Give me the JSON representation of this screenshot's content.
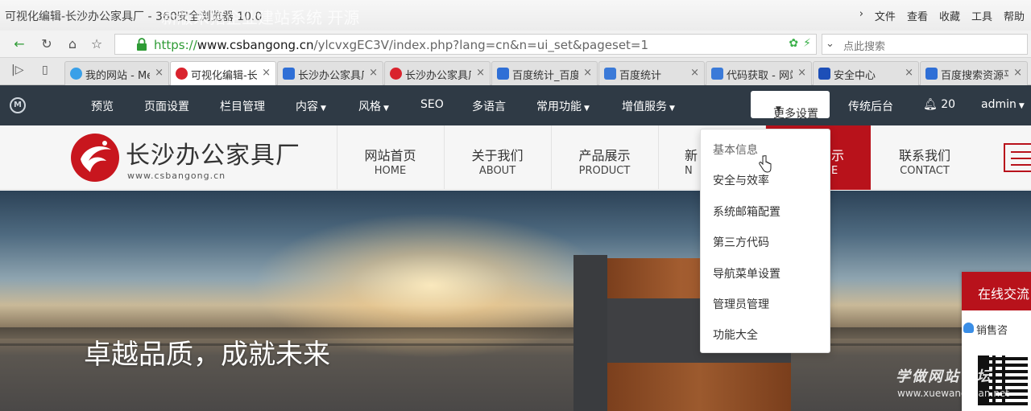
{
  "browser": {
    "window_title": "可视化编辑-长沙办公家具厂 - 360安全浏览器 10.0",
    "title_ghost": "新版米拓企业建站系统 开源",
    "menu": [
      "文件",
      "查看",
      "收藏",
      "工具",
      "帮助"
    ],
    "url_protocol": "https://",
    "url_domain": "www.csbangong.cn",
    "url_path": "/ylcvxgEC3V/index.php?lang=cn&n=ui_set&pageset=1",
    "search_placeholder": "点此搜索",
    "tabs": [
      {
        "label": "我的网站 - Me",
        "favicon_color": "#3aa0e8"
      },
      {
        "label": "可视化编辑-长沙",
        "favicon_color": "#d9232d"
      },
      {
        "label": "长沙办公家具厂",
        "favicon_color": "#2f6fd6"
      },
      {
        "label": "长沙办公家具厂",
        "favicon_color": "#d9232d"
      },
      {
        "label": "百度统计_百度",
        "favicon_color": "#2f6fd6"
      },
      {
        "label": "百度统计",
        "favicon_color": "#3b7ad8"
      },
      {
        "label": "代码获取 - 网站",
        "favicon_color": "#3b7ad8"
      },
      {
        "label": "安全中心",
        "favicon_color": "#1d4fb8"
      },
      {
        "label": "百度搜索资源平",
        "favicon_color": "#2f6fd6"
      }
    ]
  },
  "admin_bar": {
    "items": [
      "预览",
      "页面设置",
      "栏目管理",
      "内容",
      "风格",
      "SEO",
      "多语言",
      "常用功能",
      "增值服务"
    ],
    "more_settings": "更多设置",
    "classic_backend": "传统后台",
    "notification_count": "20",
    "user": "admin"
  },
  "site": {
    "brand_name": "长沙办公家具厂",
    "brand_url": "www.csbangong.cn",
    "nav": [
      {
        "zh": "网站首页",
        "en": "HOME"
      },
      {
        "zh": "关于我们",
        "en": "ABOUT"
      },
      {
        "zh": "产品展示",
        "en": "PRODUCT"
      },
      {
        "zh": "新",
        "en": "N"
      },
      {
        "zh": "示",
        "en": "E"
      },
      {
        "zh": "联系我们",
        "en": "CONTACT"
      }
    ],
    "hero_slogan": "卓越品质，成就未来"
  },
  "dropdown": {
    "items": [
      "基本信息",
      "安全与效率",
      "系统邮箱配置",
      "第三方代码",
      "导航菜单设置",
      "管理员管理",
      "功能大全"
    ]
  },
  "chat": {
    "title": "在线交流",
    "sales": "销售咨"
  },
  "watermark": {
    "text": "学做网站论坛",
    "url": "www.xuewangzhan.net"
  },
  "colors": {
    "accent_red": "#b8121b",
    "admin_bar": "#2f3a45",
    "url_green": "#2e9b35"
  }
}
